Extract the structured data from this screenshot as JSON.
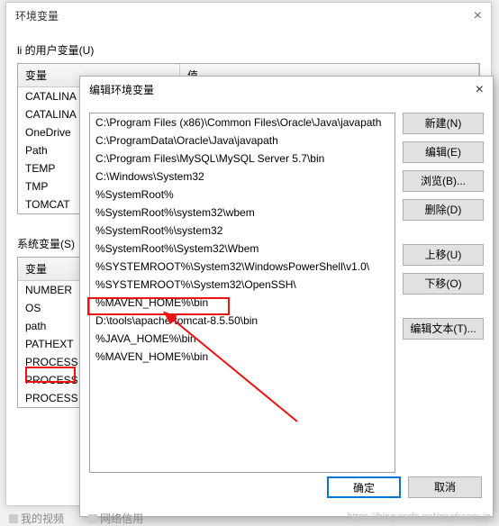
{
  "parent": {
    "title": "环境变量",
    "close": "×",
    "user_label": "li 的用户变量(U)",
    "sys_label": "系统变量(S)",
    "col_var": "变量",
    "col_val": "值",
    "user_vars": [
      "CATALINA",
      "CATALINA",
      "OneDrive",
      "Path",
      "TEMP",
      "TMP",
      "TOMCAT"
    ],
    "sys_vars": [
      "NUMBER",
      "OS",
      "path",
      "PATHEXT",
      "PROCESS",
      "PROCESS",
      "PROCESS"
    ]
  },
  "edit": {
    "title": "编辑环境变量",
    "close": "×",
    "buttons": {
      "new": "新建(N)",
      "edit": "编辑(E)",
      "browse": "浏览(B)...",
      "delete": "删除(D)",
      "up": "上移(U)",
      "down": "下移(O)",
      "edit_text": "编辑文本(T)...",
      "ok": "确定",
      "cancel": "取消"
    },
    "paths": [
      "C:\\Program Files (x86)\\Common Files\\Oracle\\Java\\javapath",
      "C:\\ProgramData\\Oracle\\Java\\javapath",
      "C:\\Program Files\\MySQL\\MySQL Server 5.7\\bin",
      "C:\\Windows\\System32",
      "%SystemRoot%",
      "%SystemRoot%\\system32\\wbem",
      "%SystemRoot%\\system32",
      "%SystemRoot%\\System32\\Wbem",
      "%SYSTEMROOT%\\System32\\WindowsPowerShell\\v1.0\\",
      "%SYSTEMROOT%\\System32\\OpenSSH\\",
      "%MAVEN_HOME%\\bin",
      "D:\\tools\\apache-tomcat-8.5.50\\bin",
      "%JAVA_HOME%\\bin",
      "%MAVEN_HOME%\\bin"
    ]
  },
  "taskbar": {
    "item1": "我的视频",
    "item2": "网络信用"
  },
  "watermark": "https://blog.csdn.net/mydream.jg"
}
